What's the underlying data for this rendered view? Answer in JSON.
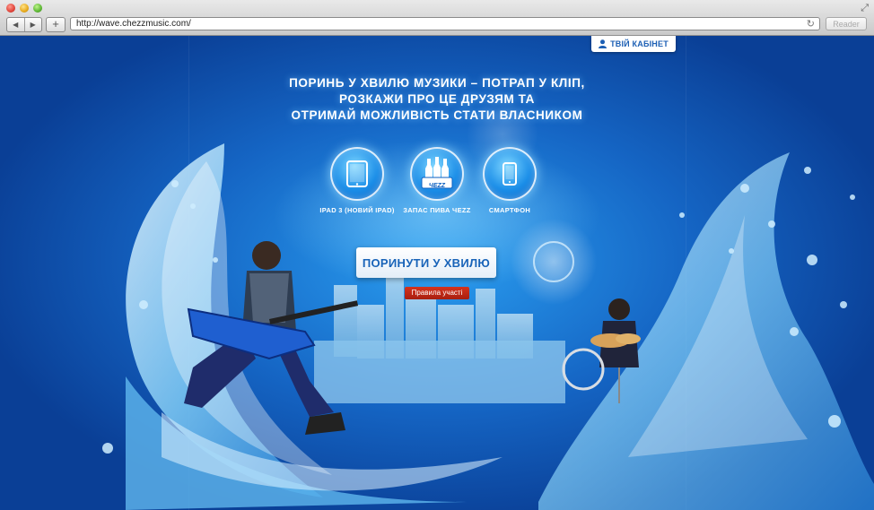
{
  "browser": {
    "url": "http://wave.chezzmusic.com/",
    "reader_label": "Reader",
    "add_label": "+"
  },
  "page": {
    "cabinet_label": "ТВІЙ КАБІНЕТ",
    "headline": [
      "ПОРИНЬ У ХВИЛЮ МУЗИКИ – ПОТРАП У КЛІП,",
      "РОЗКАЖИ ПРО ЦЕ ДРУЗЯМ ТА",
      "ОТРИМАЙ МОЖЛИВІСТЬ СТАТИ ВЛАСНИКОМ"
    ],
    "prizes": [
      {
        "label": "IPAD 3 (НОВИЙ IPAD)",
        "icon": "tablet-icon"
      },
      {
        "label": "ЗАПАС ПИВА ЧEZZ",
        "icon": "beer-bottles-icon",
        "logo_text": "ЧEZZ"
      },
      {
        "label": "СМАРТФОН",
        "icon": "smartphone-icon"
      }
    ],
    "cta_label": "ПОРИНУТИ У ХВИЛЮ",
    "rules_label": "Правила участі"
  },
  "colors": {
    "background": "#1565c4",
    "accent_text": "#1863b8",
    "rules_button": "#c0281a"
  }
}
